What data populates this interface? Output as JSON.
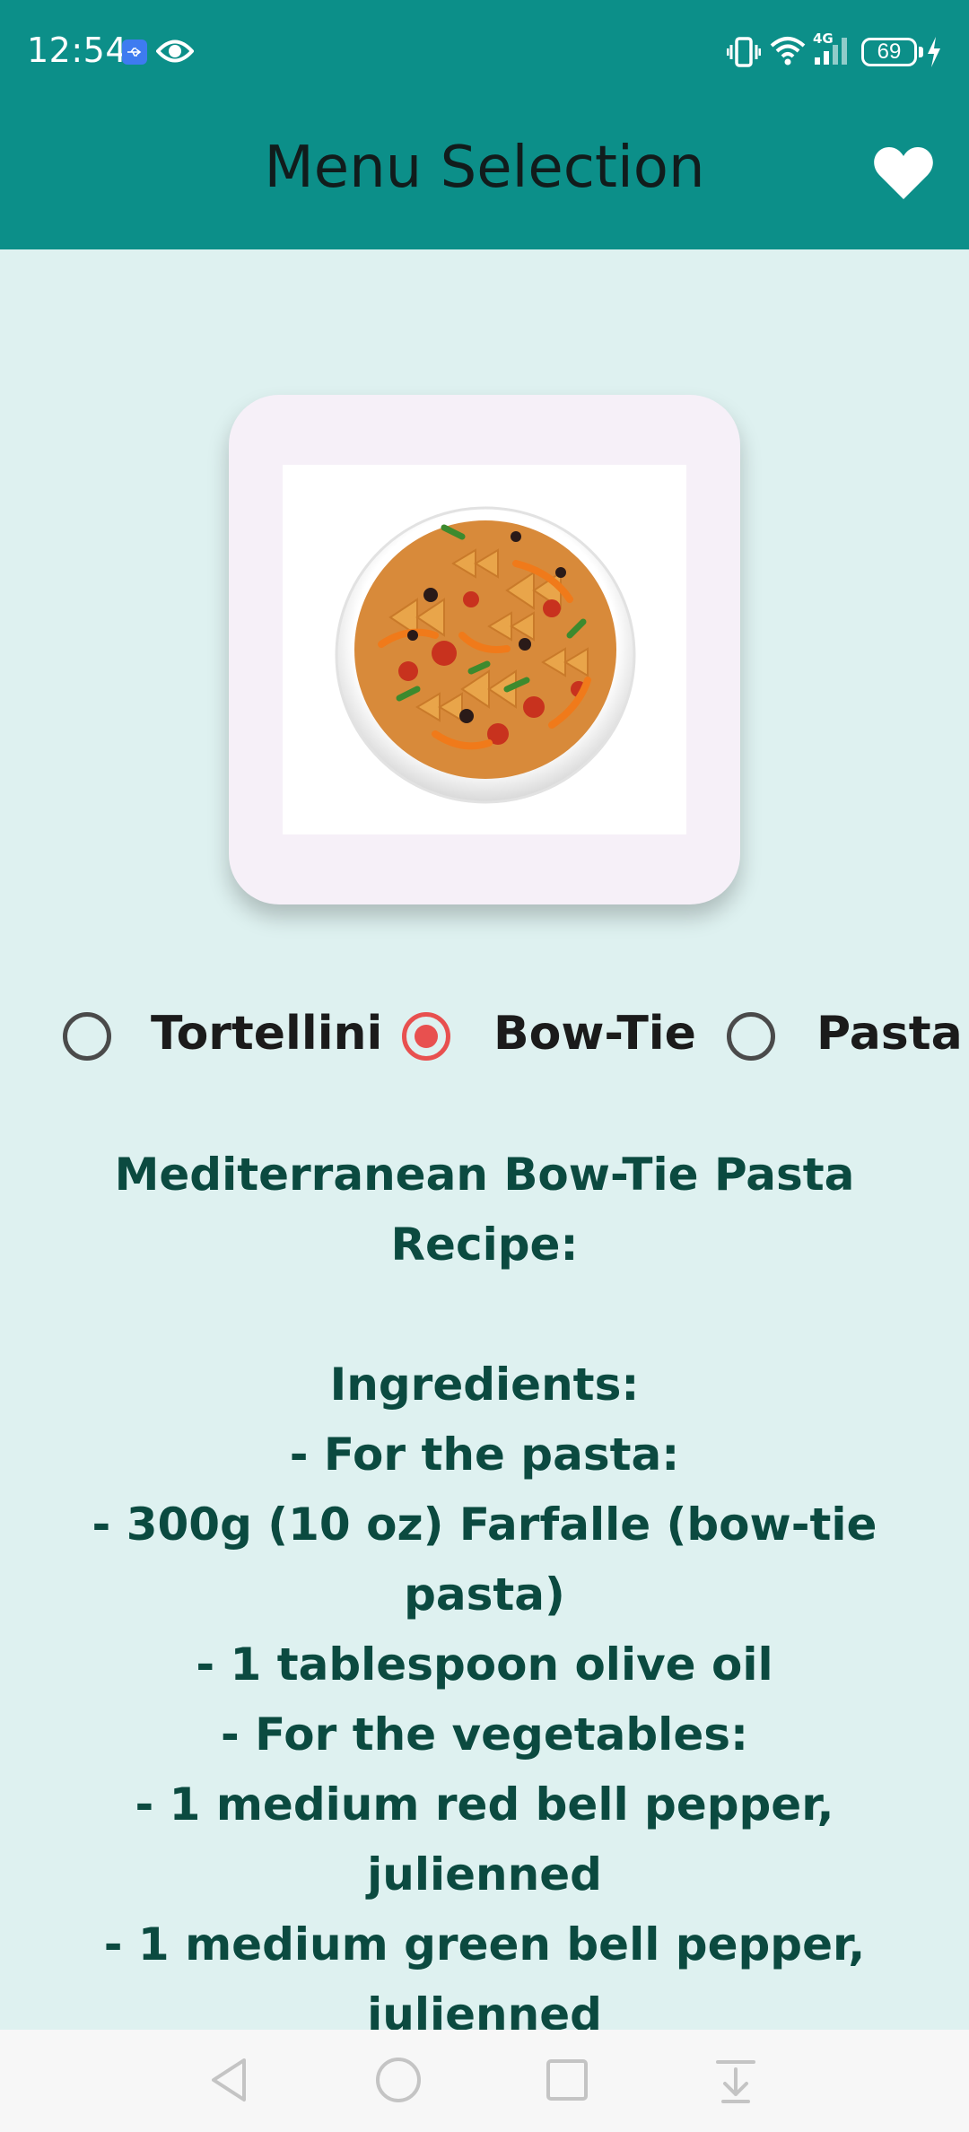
{
  "status_bar": {
    "time": "12:54",
    "battery": "69",
    "network": "4G",
    "icons": [
      "usb-icon",
      "eye-icon",
      "vibrate-icon",
      "wifi-icon",
      "signal-icon",
      "battery-icon",
      "charging-bolt-icon"
    ]
  },
  "app_bar": {
    "title": "Menu Selection",
    "favorite_icon": "heart-icon"
  },
  "dish_image": {
    "description_icon": "bow-tie-pasta-dish"
  },
  "radio_group": {
    "options": [
      {
        "label": "Tortellini",
        "checked": false
      },
      {
        "label": "Bow-Tie",
        "checked": true
      },
      {
        "label": "Pasta",
        "checked": false
      }
    ]
  },
  "recipe": {
    "lines": [
      "Mediterranean Bow-Tie Pasta",
      "Recipe:",
      "",
      "Ingredients:",
      "- For the pasta:",
      "- 300g (10 oz) Farfalle (bow-tie",
      "pasta)",
      "- 1 tablespoon olive oil",
      "- For the vegetables:",
      "- 1 medium red bell pepper,",
      "julienned",
      "- 1 medium green bell pepper,",
      "julienned"
    ]
  },
  "nav_bar": {
    "buttons": [
      "back-icon",
      "home-icon",
      "recents-icon",
      "notification-pulldown-icon"
    ]
  },
  "colors": {
    "app_bar": "#0c8f89",
    "background": "#def1f0",
    "radio_checked": "#e8504f",
    "recipe_text": "#0b4a40"
  }
}
